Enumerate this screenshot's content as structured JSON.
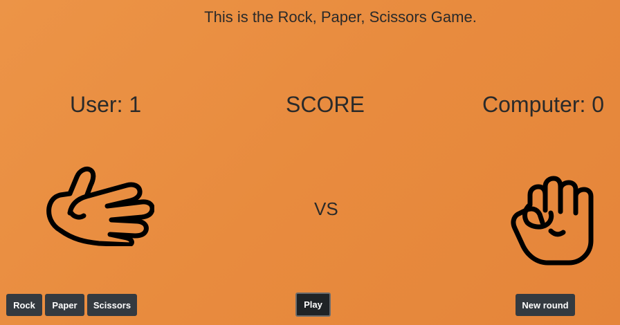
{
  "header": {
    "title": "This is the Rock, Paper, Scissors Game."
  },
  "score": {
    "user": "User: 1",
    "label": "SCORE",
    "computer": "Computer: 0"
  },
  "arena": {
    "user_choice_icon": "paper-hand-icon",
    "computer_choice_icon": "rock-fist-icon",
    "vs_label": "VS"
  },
  "controls": {
    "rock_label": "Rock",
    "paper_label": "Paper",
    "scissors_label": "Scissors",
    "play_label": "Play",
    "new_round_label": "New round"
  },
  "colors": {
    "background": "#e88b3e",
    "button": "#343a40",
    "button_text": "#ffffff",
    "text": "#2a2a2a"
  }
}
